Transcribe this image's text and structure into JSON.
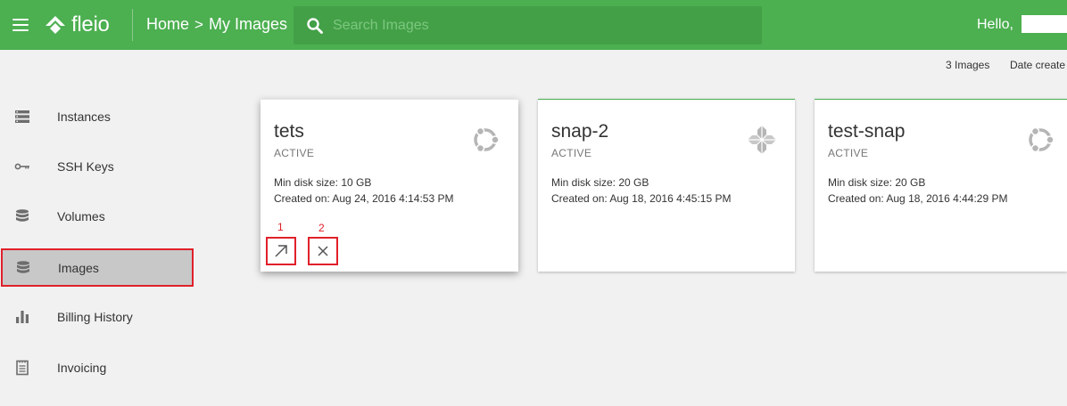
{
  "header": {
    "logo_text": "fleio",
    "breadcrumb": {
      "home": "Home",
      "separator": ">",
      "current": "My Images"
    },
    "search_placeholder": "Search Images",
    "greeting": "Hello,"
  },
  "subbar": {
    "count": "3 Images",
    "sort": "Date create"
  },
  "sidebar": {
    "items": [
      {
        "label": "Instances",
        "icon": "server-list-icon"
      },
      {
        "label": "SSH Keys",
        "icon": "key-icon"
      },
      {
        "label": "Volumes",
        "icon": "database-icon"
      },
      {
        "label": "Images",
        "icon": "images-icon",
        "active": true
      },
      {
        "label": "Billing History",
        "icon": "bar-chart-icon"
      },
      {
        "label": "Invoicing",
        "icon": "invoice-icon"
      }
    ]
  },
  "cards": [
    {
      "title": "tets",
      "status": "ACTIVE",
      "disk": "Min disk size: 10 GB",
      "created": "Created on: Aug 24, 2016 4:14:53 PM",
      "os_icon": "ubuntu-icon"
    },
    {
      "title": "snap-2",
      "status": "ACTIVE",
      "disk": "Min disk size: 20 GB",
      "created": "Created on: Aug 18, 2016 4:45:15 PM",
      "os_icon": "centos-icon"
    },
    {
      "title": "test-snap",
      "status": "ACTIVE",
      "disk": "Min disk size: 20 GB",
      "created": "Created on: Aug 18, 2016 4:44:29 PM",
      "os_icon": "ubuntu-icon"
    }
  ],
  "annotations": {
    "first": "1",
    "second": "2"
  },
  "colors": {
    "brand_green": "#4caf50",
    "highlight_red": "#e0202a",
    "icon_grey": "#b5b5b5"
  }
}
